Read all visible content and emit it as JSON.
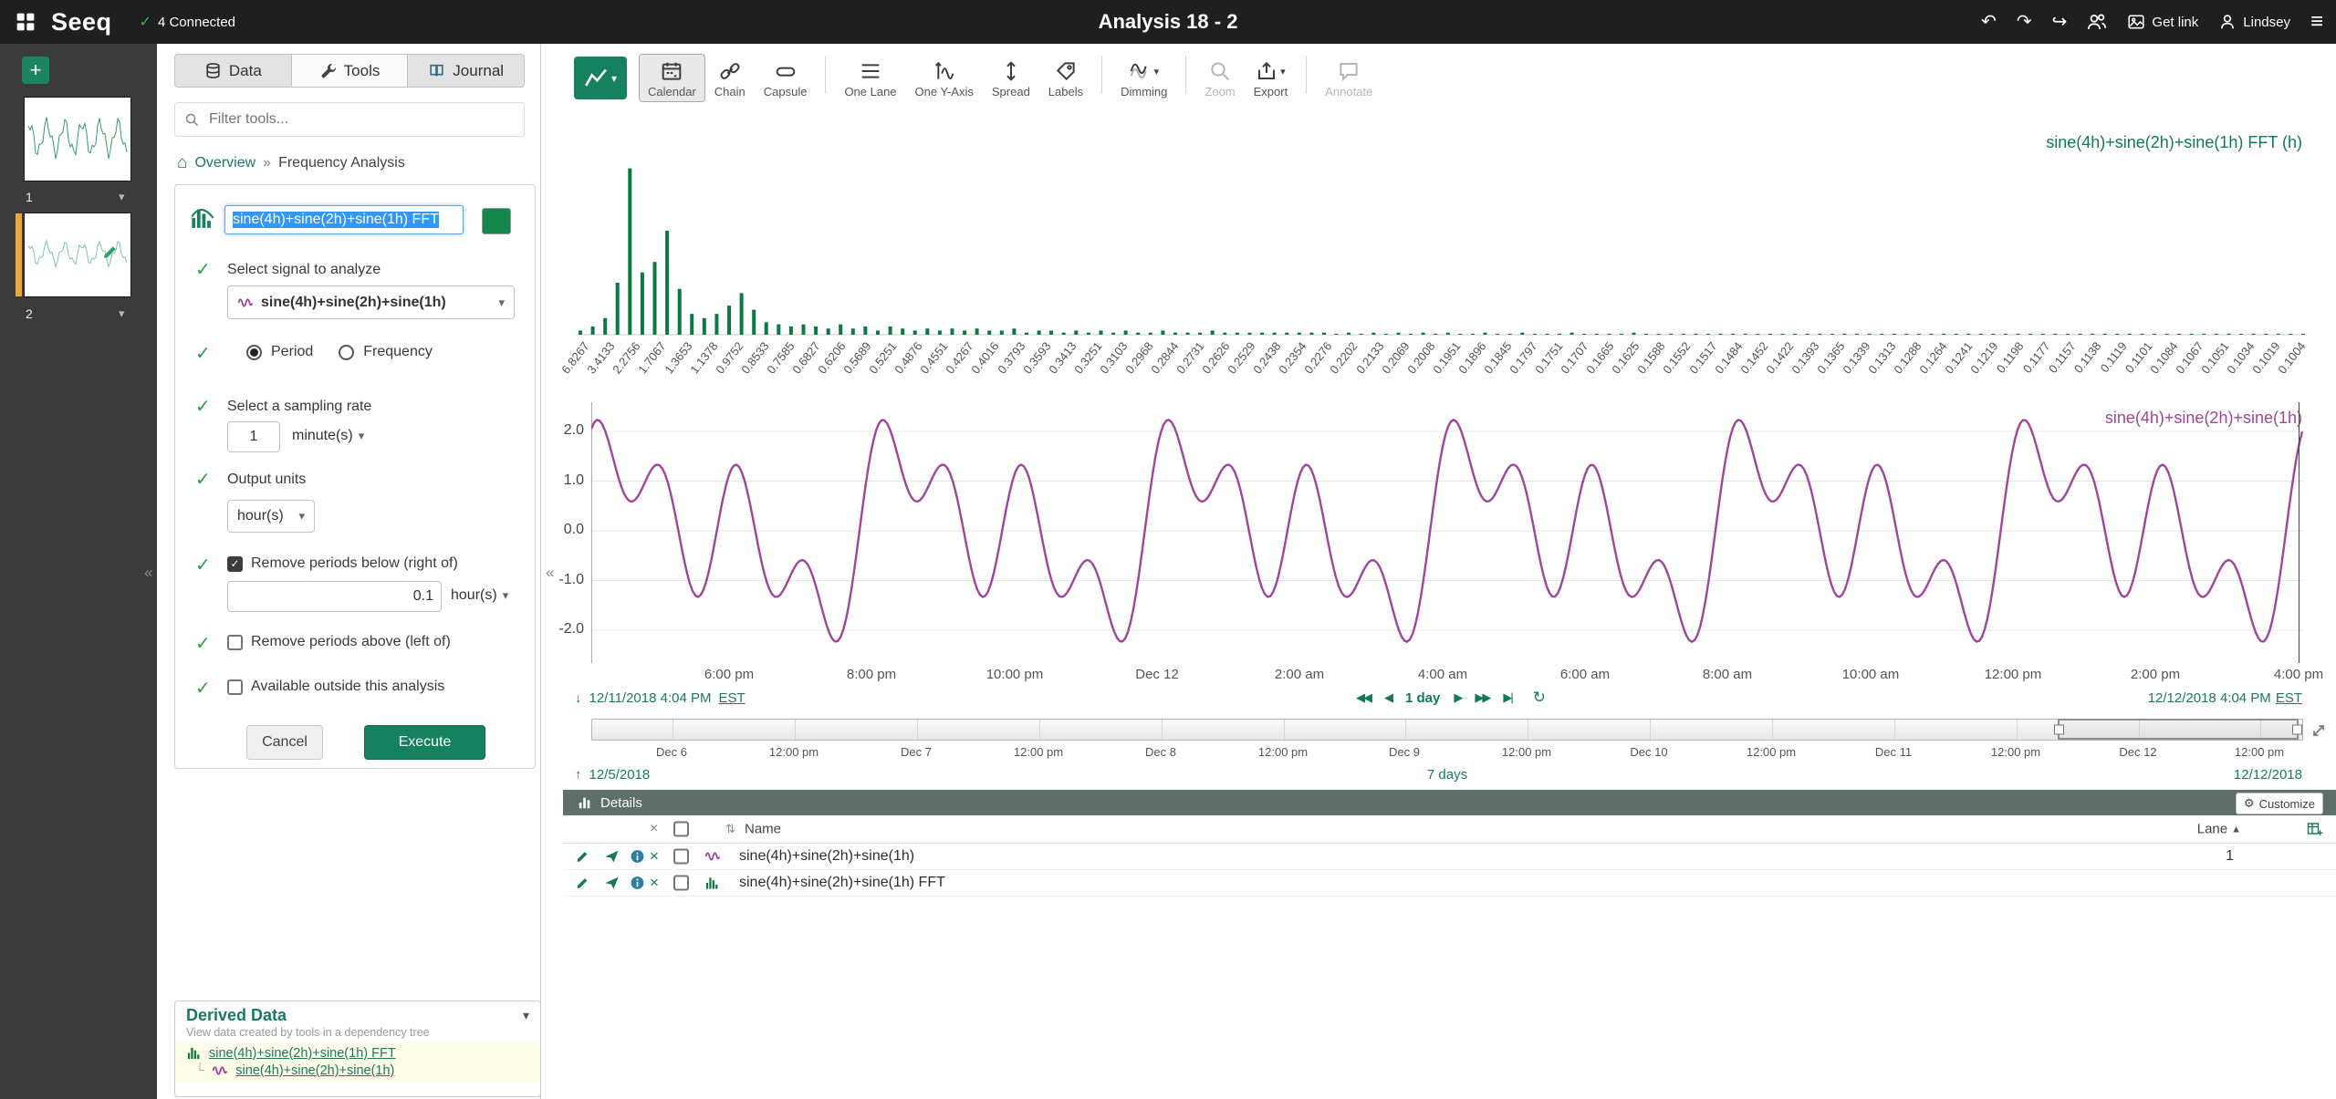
{
  "colors": {
    "brand_green": "#197a60",
    "button_green": "#15815f",
    "fft_bar_green": "#0c7a40",
    "check_green": "#27a347",
    "series_purple": "#a0459b",
    "details_header_bg": "#5e6e68",
    "active_worksheet_orange": "#f0a636",
    "selection_blue": "#3297fd",
    "topbar_bg": "#1f1f1f"
  },
  "icons": {
    "undo": "↶",
    "redo": "↷",
    "share": "↪",
    "menu": "≡",
    "home": "⌂",
    "chevron_down": "▾",
    "collapse": "«",
    "breadcrumb_sep": "»",
    "check": "✓",
    "close": "×",
    "sort": "⇅",
    "sort_asc": "▲",
    "step_back_fast": "◀◀",
    "step_back": "◀",
    "step_fwd": "▶",
    "step_fwd_fast": "▶▶",
    "step_end": "▶|",
    "refresh": "↻",
    "arrow_down": "↓",
    "arrow_up": "↑",
    "gear": "⚙",
    "plus": "+",
    "caret": "▾",
    "expand": "⤢"
  },
  "topbar": {
    "title": "Analysis 18 - 2",
    "connected_label": "4 Connected",
    "get_link_label": "Get link",
    "user_name": "Lindsey"
  },
  "worksheets": {
    "items": [
      {
        "label": "1",
        "active": false
      },
      {
        "label": "2",
        "active": true
      }
    ]
  },
  "tools_panel": {
    "tabs": [
      {
        "label": "Data",
        "icon": "data",
        "active": false
      },
      {
        "label": "Tools",
        "icon": "tools",
        "active": true
      },
      {
        "label": "Journal",
        "icon": "journal",
        "active": false
      }
    ],
    "filter_placeholder": "Filter tools...",
    "breadcrumb": {
      "home_label": "Overview",
      "current": "Frequency Analysis"
    },
    "form": {
      "name": "sine(4h)+sine(2h)+sine(1h) FFT",
      "signal_label": "Select signal to analyze",
      "signal_value": "sine(4h)+sine(2h)+sine(1h)",
      "period_option": "Period",
      "frequency_option": "Frequency",
      "sampling_label": "Select a sampling rate",
      "sampling_value": "1",
      "sampling_unit": "minute(s)",
      "output_label": "Output units",
      "output_unit": "hour(s)",
      "remove_below_label": "Remove periods below (right of)",
      "remove_below_value": "0.1",
      "remove_below_unit": "hour(s)",
      "remove_above_label": "Remove periods above (left of)",
      "available_label": "Available outside this analysis",
      "cancel_label": "Cancel",
      "execute_label": "Execute"
    },
    "derived_data": {
      "title": "Derived Data",
      "subtitle": "View data created by tools in a dependency tree",
      "items": [
        {
          "icon": "fft",
          "label": "sine(4h)+sine(2h)+sine(1h) FFT",
          "child": false
        },
        {
          "icon": "signal",
          "label": "sine(4h)+sine(2h)+sine(1h)",
          "child": true
        }
      ]
    }
  },
  "toolbar": {
    "items": [
      {
        "icon": "calendar",
        "label": "Calendar",
        "active": true
      },
      {
        "icon": "chain",
        "label": "Chain"
      },
      {
        "icon": "capsule",
        "label": "Capsule"
      },
      {
        "type": "sep"
      },
      {
        "icon": "onelane",
        "label": "One Lane"
      },
      {
        "icon": "oneyaxis",
        "label": "One Y-Axis"
      },
      {
        "icon": "spread",
        "label": "Spread"
      },
      {
        "icon": "labels",
        "label": "Labels"
      },
      {
        "type": "sep"
      },
      {
        "icon": "dimming",
        "label": "Dimming",
        "caret": true
      },
      {
        "type": "sep"
      },
      {
        "icon": "zoom",
        "label": "Zoom",
        "disabled": true
      },
      {
        "icon": "export",
        "label": "Export",
        "caret": true
      },
      {
        "type": "sep"
      },
      {
        "icon": "annotate",
        "label": "Annotate",
        "disabled": true
      }
    ]
  },
  "chart_data": [
    {
      "type": "bar",
      "title": "sine(4h)+sine(2h)+sine(1h) FFT (h)",
      "color": "#0c7a40",
      "ylim": [
        0,
        1
      ],
      "note": "FFT periodogram of sine(4h)+sine(2h)+sine(1h); dominant peaks at periods near 4h, 2h and 1h; x axis is period in hours",
      "x_tick_labels": [
        "6.8267",
        "3.4133",
        "2.2756",
        "1.7067",
        "1.3653",
        "1.1378",
        "0.9752",
        "0.8533",
        "0.7585",
        "0.6827",
        "0.6206",
        "0.5689",
        "0.5251",
        "0.4876",
        "0.4551",
        "0.4267",
        "0.4016",
        "0.3793",
        "0.3593",
        "0.3413",
        "0.3251",
        "0.3103",
        "0.2968",
        "0.2844",
        "0.2731",
        "0.2626",
        "0.2529",
        "0.2438",
        "0.2354",
        "0.2276",
        "0.2202",
        "0.2133",
        "0.2069",
        "0.2008",
        "0.1951",
        "0.1896",
        "0.1845",
        "0.1797",
        "0.1751",
        "0.1707",
        "0.1665",
        "0.1625",
        "0.1588",
        "0.1552",
        "0.1517",
        "0.1484",
        "0.1452",
        "0.1422",
        "0.1393",
        "0.1365",
        "0.1339",
        "0.1313",
        "0.1288",
        "0.1264",
        "0.1241",
        "0.1219",
        "0.1198",
        "0.1177",
        "0.1157",
        "0.1138",
        "0.1119",
        "0.1101",
        "0.1084",
        "0.1067",
        "0.1051",
        "0.1034",
        "0.1019",
        "0.1004"
      ],
      "bar_heights": [
        0.02,
        0.04,
        0.08,
        0.25,
        0.8,
        0.3,
        0.35,
        0.5,
        0.22,
        0.1,
        0.08,
        0.1,
        0.14,
        0.2,
        0.12,
        0.06,
        0.05,
        0.04,
        0.05,
        0.04,
        0.03,
        0.05,
        0.03,
        0.04,
        0.02,
        0.04,
        0.03,
        0.02,
        0.03,
        0.02,
        0.03,
        0.02,
        0.03,
        0.02,
        0.02,
        0.03,
        0.01,
        0.02,
        0.02,
        0.01,
        0.02,
        0.01,
        0.02,
        0.01,
        0.02,
        0.01,
        0.01,
        0.02,
        0.01,
        0.01,
        0.01,
        0.02,
        0.01,
        0.01,
        0.01,
        0.01,
        0.01,
        0.01,
        0.01,
        0.01,
        0.01,
        0.005,
        0.01,
        0.005,
        0.01,
        0.005,
        0.01,
        0.005,
        0.01,
        0.005,
        0.01,
        0.005,
        0.005,
        0.01,
        0.005,
        0.005,
        0.01,
        0.005,
        0.005,
        0.005,
        0.01,
        0.005,
        0.005,
        0.005,
        0.005,
        0.01,
        0.005,
        0.005,
        0.005,
        0.005,
        0.005,
        0.005,
        0.005,
        0.005,
        0.005,
        0.005,
        0.005,
        0.005,
        0.005,
        0.005,
        0.005,
        0.005,
        0.005,
        0.005,
        0.005,
        0.005,
        0.005,
        0.005,
        0.005,
        0.005,
        0.005,
        0.005,
        0.005,
        0.005,
        0.005,
        0.005,
        0.005,
        0.005,
        0.005,
        0.005,
        0.005,
        0.005,
        0.005,
        0.005,
        0.005,
        0.005,
        0.005,
        0.005,
        0.005,
        0.005,
        0.005,
        0.005,
        0.005,
        0.005,
        0.005,
        0.005,
        0.005,
        0.005,
        0.005,
        0.005
      ]
    },
    {
      "type": "line",
      "title": "sine(4h)+sine(2h)+sine(1h)",
      "color": "#a0459b",
      "y_ticks": [
        {
          "label": "2.0",
          "value": 2
        },
        {
          "label": "1.0",
          "value": 1
        },
        {
          "label": "0.0",
          "value": 0
        },
        {
          "label": "-1.0",
          "value": -1
        },
        {
          "label": "-2.0",
          "value": -2
        }
      ],
      "x_range": {
        "start": "12/11/2018 4:04 PM EST",
        "end": "12/12/2018 4:04 PM EST",
        "hours": 24
      },
      "components": [
        {
          "period_hours": 4,
          "amplitude": 1
        },
        {
          "period_hours": 2,
          "amplitude": 1
        },
        {
          "period_hours": 1,
          "amplitude": 1
        }
      ],
      "time_shift_hours": 0.24,
      "x_ticks": [
        {
          "label": "6:00 pm",
          "frac": 0.0804
        },
        {
          "label": "8:00 pm",
          "frac": 0.1638
        },
        {
          "label": "10:00 pm",
          "frac": 0.2471
        },
        {
          "label": "Dec 12",
          "frac": 0.3304
        },
        {
          "label": "2:00 am",
          "frac": 0.4138
        },
        {
          "label": "4:00 am",
          "frac": 0.4971
        },
        {
          "label": "6:00 am",
          "frac": 0.5804
        },
        {
          "label": "8:00 am",
          "frac": 0.6638
        },
        {
          "label": "10:00 am",
          "frac": 0.7471
        },
        {
          "label": "12:00 pm",
          "frac": 0.8304
        },
        {
          "label": "2:00 pm",
          "frac": 0.9138
        },
        {
          "label": "4:00 pm",
          "frac": 0.9971
        }
      ]
    }
  ],
  "range_bar": {
    "start": "12/11/2018 4:04 PM",
    "start_tz": "EST",
    "end": "12/12/2018 4:04 PM",
    "end_tz": "EST",
    "step_label": "1 day"
  },
  "timeline": {
    "start": "12/5/2018",
    "end": "12/12/2018",
    "duration_label": "7 days",
    "selection": {
      "start_frac": 0.857,
      "end_frac": 0.998
    },
    "ticks": [
      {
        "label": "Dec 6",
        "frac": 0.0472
      },
      {
        "label": "12:00 pm",
        "frac": 0.1186
      },
      {
        "label": "Dec 7",
        "frac": 0.19
      },
      {
        "label": "12:00 pm",
        "frac": 0.2615
      },
      {
        "label": "Dec 8",
        "frac": 0.3329
      },
      {
        "label": "12:00 pm",
        "frac": 0.4043
      },
      {
        "label": "Dec 9",
        "frac": 0.4757
      },
      {
        "label": "12:00 pm",
        "frac": 0.5472
      },
      {
        "label": "Dec 10",
        "frac": 0.6186
      },
      {
        "label": "12:00 pm",
        "frac": 0.69
      },
      {
        "label": "Dec 11",
        "frac": 0.7615
      },
      {
        "label": "12:00 pm",
        "frac": 0.8329
      },
      {
        "label": "Dec 12",
        "frac": 0.9043
      },
      {
        "label": "12:00 pm",
        "frac": 0.9757
      }
    ]
  },
  "details": {
    "title": "Details",
    "customize_label": "Customize",
    "name_column": "Name",
    "lane_column": "Lane",
    "rows": [
      {
        "icon": "signal",
        "name": "sine(4h)+sine(2h)+sine(1h)",
        "lane": "1"
      },
      {
        "icon": "fft",
        "name": "sine(4h)+sine(2h)+sine(1h) FFT",
        "lane": ""
      }
    ]
  }
}
